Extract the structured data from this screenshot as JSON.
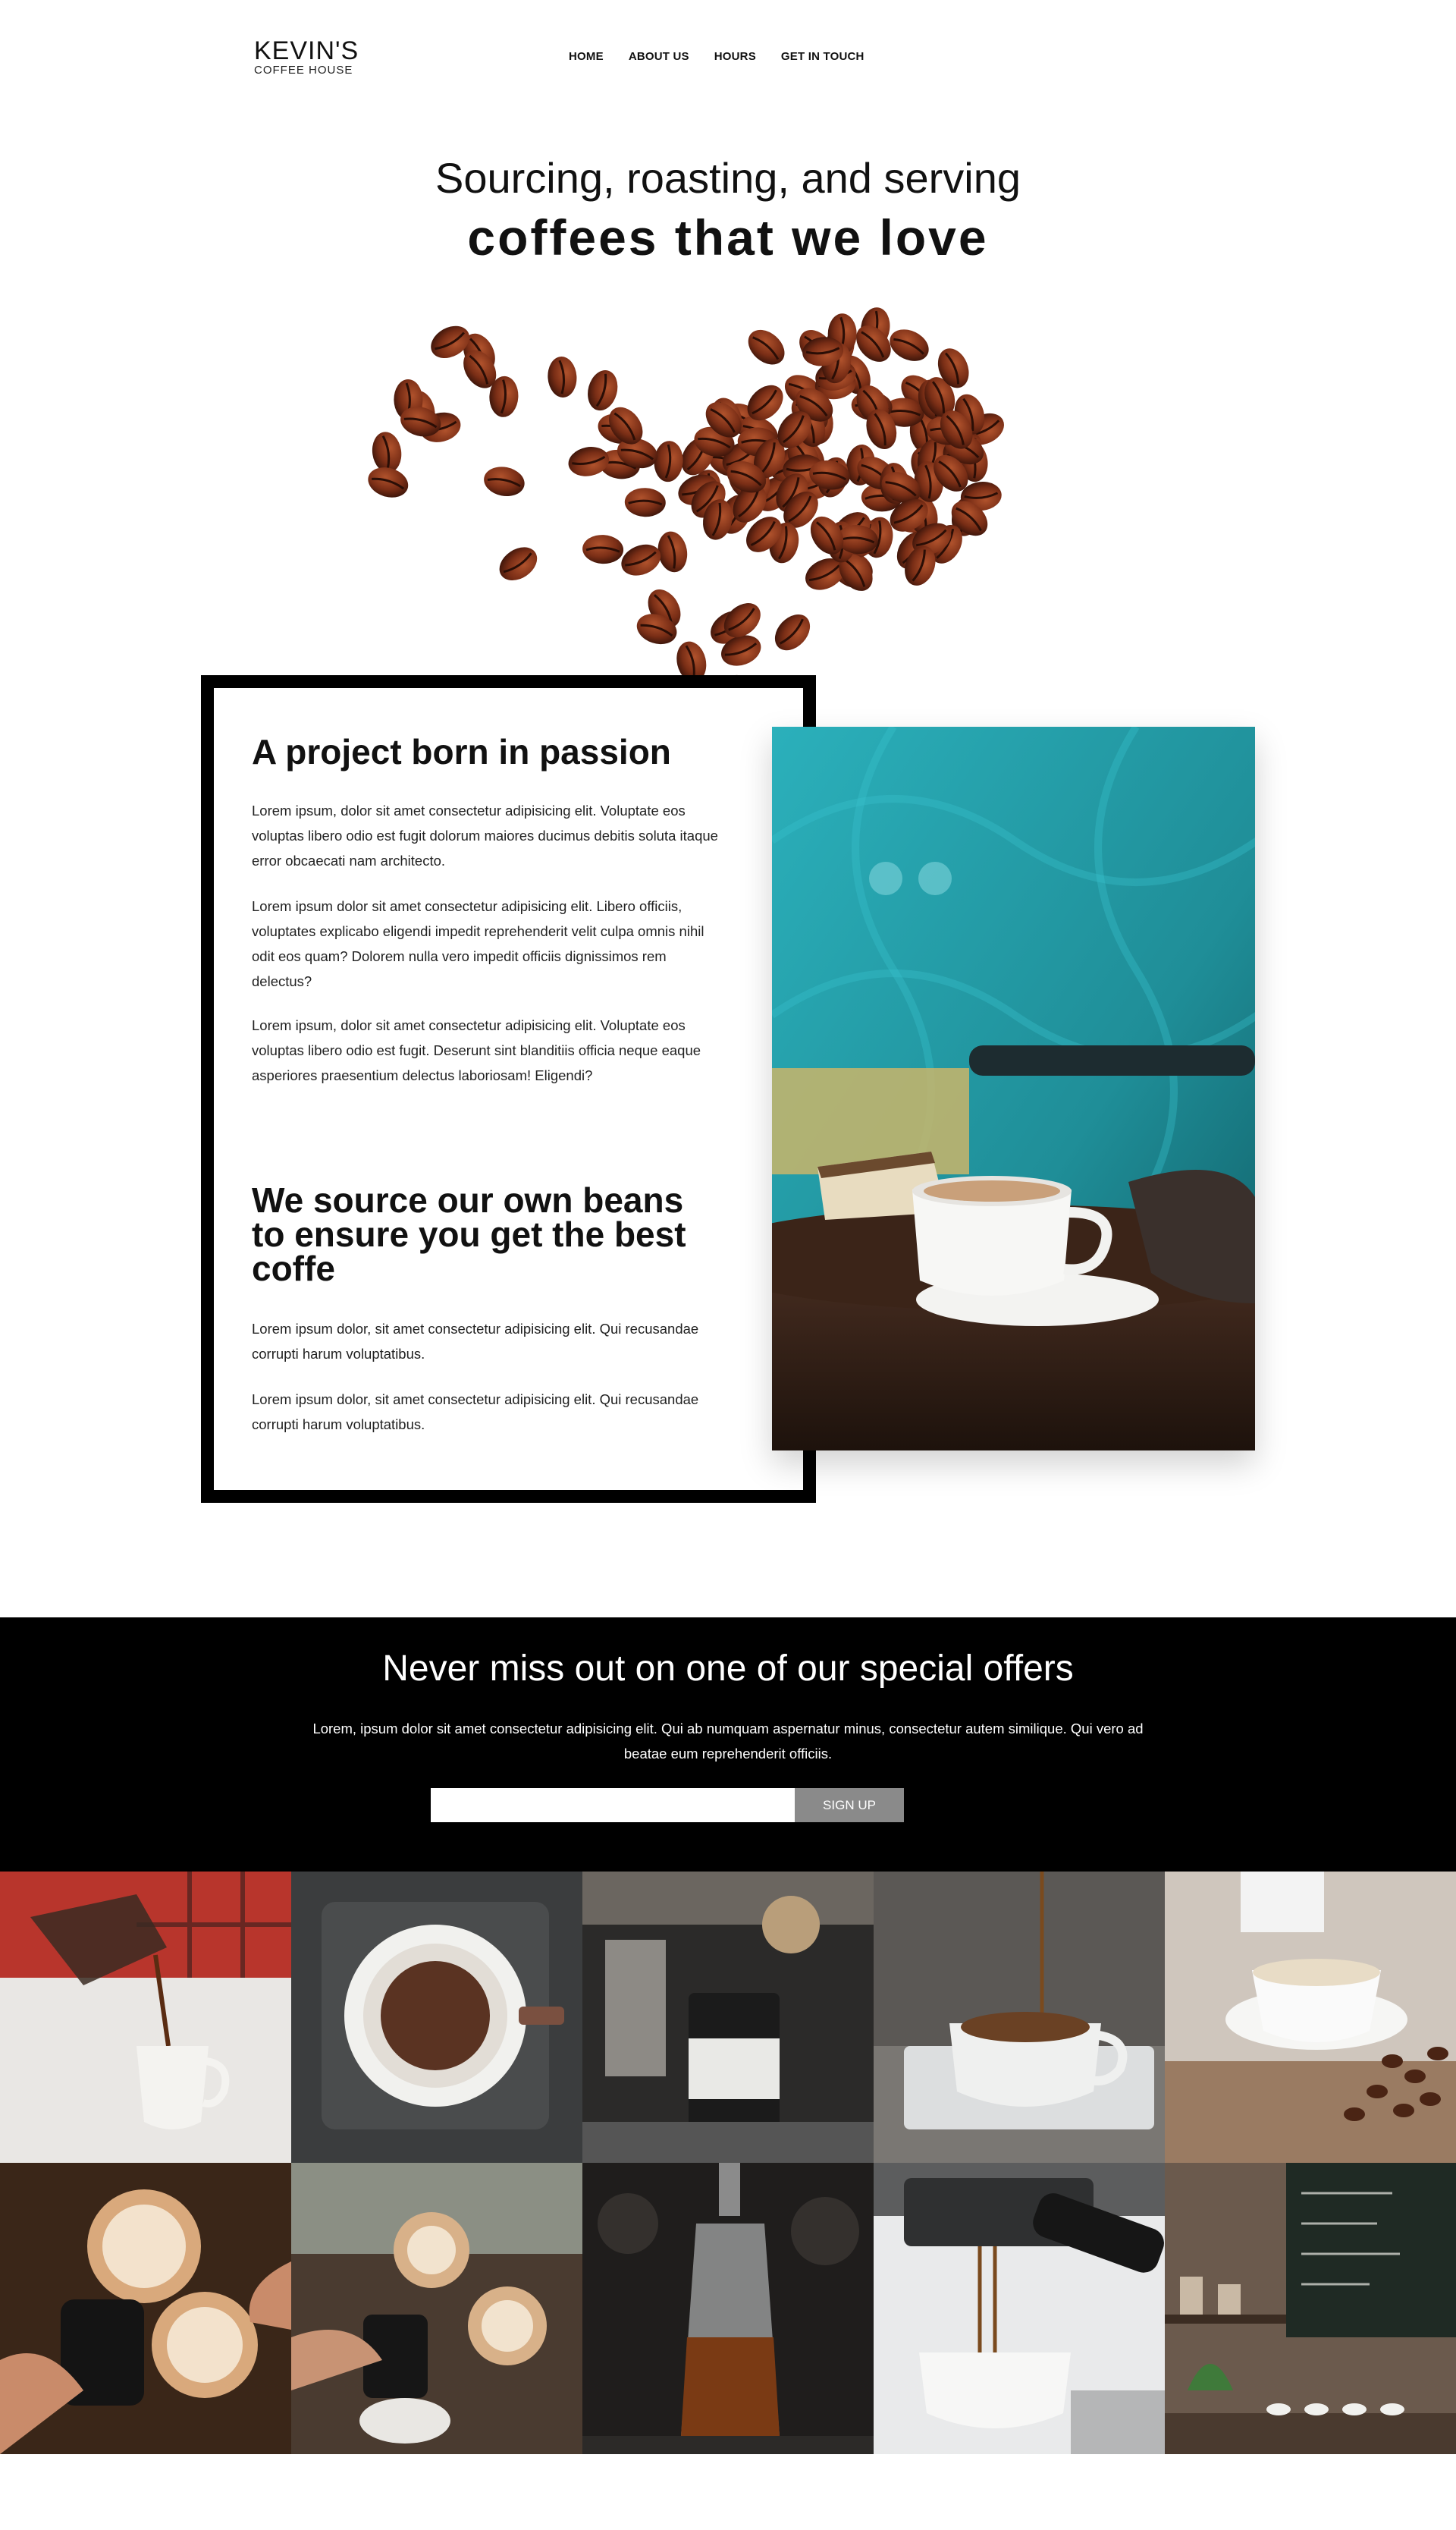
{
  "brand": {
    "name": "KEVIN'S",
    "tagline": "COFFEE HOUSE"
  },
  "nav": {
    "items": [
      {
        "label": "HOME"
      },
      {
        "label": "ABOUT US"
      },
      {
        "label": "HOURS"
      },
      {
        "label": "GET IN TOUCH"
      }
    ]
  },
  "hero": {
    "line1": "Sourcing, roasting, and serving",
    "line2": "coffees that we love"
  },
  "story": {
    "heading": "A project born in passion",
    "paragraphs": [
      "Lorem ipsum, dolor sit amet consectetur adipisicing elit. Voluptate eos voluptas libero odio est fugit dolorum maiores ducimus debitis soluta itaque error obcaecati nam architecto.",
      "Lorem ipsum dolor sit amet consectetur adipisicing elit. Libero officiis, voluptates explicabo eligendi impedit reprehenderit velit culpa omnis nihil odit eos quam? Dolorem nulla vero impedit officiis dignissimos rem delectus?",
      "Lorem ipsum, dolor sit amet consectetur adipisicing elit. Voluptate eos voluptas libero odio est fugit. Deserunt sint blanditiis officia neque eaque asperiores praesentium delectus laboriosam! Eligendi?"
    ],
    "heading2": "We source our own beans to ensure you get the best coffe",
    "paragraphs2": [
      "Lorem ipsum dolor, sit amet consectetur adipisicing elit. Qui recusandae corrupti harum voluptatibus.",
      "Lorem ipsum dolor, sit amet consectetur adipisicing elit. Qui recusandae corrupti harum voluptatibus."
    ]
  },
  "offers": {
    "title": "Never miss out on one of our special offers",
    "text": "Lorem, ipsum dolor sit amet consectetur adipisicing elit. Qui ab numquam aspernatur minus, consectetur autem similique. Qui vero ad beatae eum reprehenderit officiis.",
    "input_value": "",
    "button_label": "SIGN UP"
  },
  "colors": {
    "accent_black": "#000000",
    "button_gray": "#8a8a8a",
    "teal_wall": "#2aa3ad"
  }
}
